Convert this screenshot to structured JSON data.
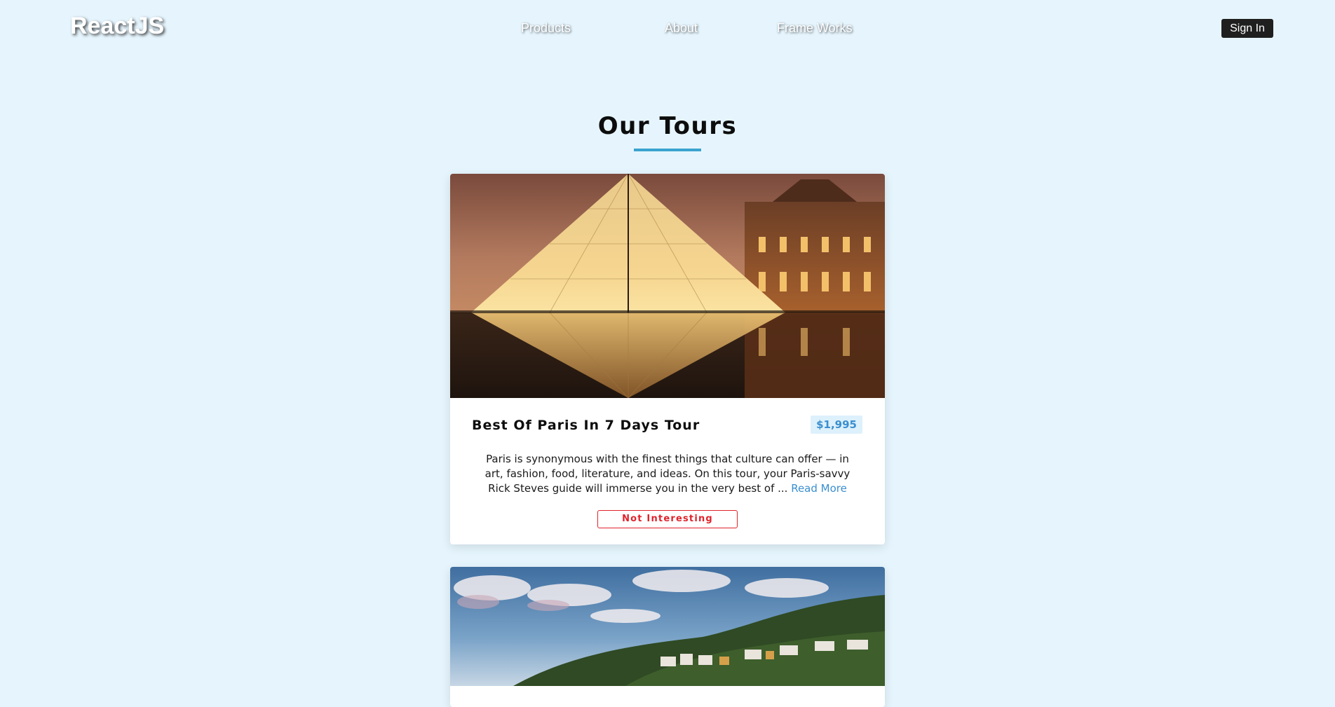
{
  "navbar": {
    "logo": "ReactJS",
    "links": [
      {
        "label": "Products"
      },
      {
        "label": "About"
      },
      {
        "label": "Frame Works"
      }
    ],
    "signin_label": "Sign In"
  },
  "section": {
    "title": "Our Tours"
  },
  "tours": [
    {
      "name": "Best Of Paris In 7 Days Tour",
      "price": "$1,995",
      "description": "Paris is synonymous with the finest things that culture can offer — in art, fashion, food, literature, and ideas. On this tour, your Paris-savvy Rick Steves guide will immerse you in the very best of ...",
      "read_more": "Read More",
      "dismiss_label": "Not Interesting",
      "image_subject": "Louvre pyramid at night"
    },
    {
      "image_subject": "hillside village under cloudy sky"
    }
  ],
  "colors": {
    "background": "#e6f5fd",
    "accent": "#3aa3cf",
    "price_text": "#3a8fd0",
    "danger": "#e0232b"
  }
}
